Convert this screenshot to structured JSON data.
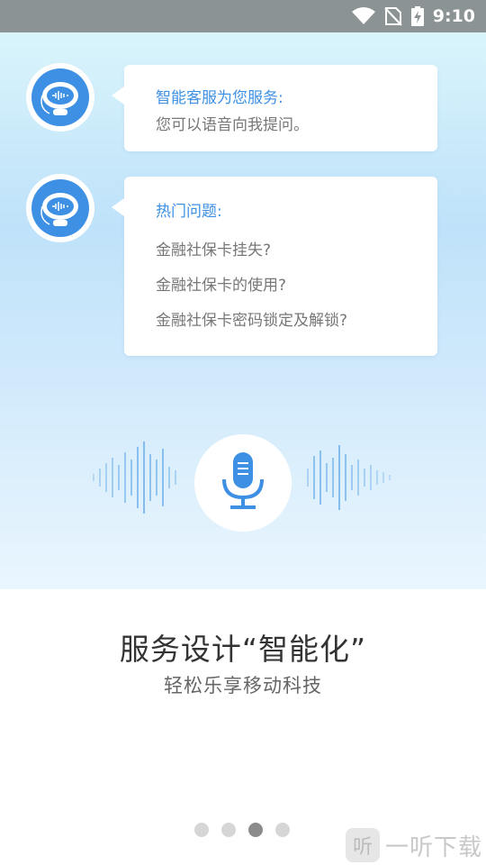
{
  "status_bar": {
    "time": "9:10"
  },
  "greeting": {
    "title": "智能客服为您服务:",
    "text": "您可以语音向我提问。"
  },
  "hot_questions": {
    "title": "热门问题:",
    "items": [
      "金融社保卡挂失?",
      "金融社保卡的使用?",
      "金融社保卡密码锁定及解锁?"
    ]
  },
  "mic": {
    "icon": "microphone-icon"
  },
  "feature": {
    "headline": "服务设计“智能化”",
    "subline": "轻松乐享移动科技"
  },
  "pager": {
    "count": 4,
    "active_index": 2
  },
  "watermark": {
    "logo_text": "听",
    "text": "一听下载"
  },
  "colors": {
    "accent": "#3d90e4",
    "status_bar": "#8c9394"
  }
}
